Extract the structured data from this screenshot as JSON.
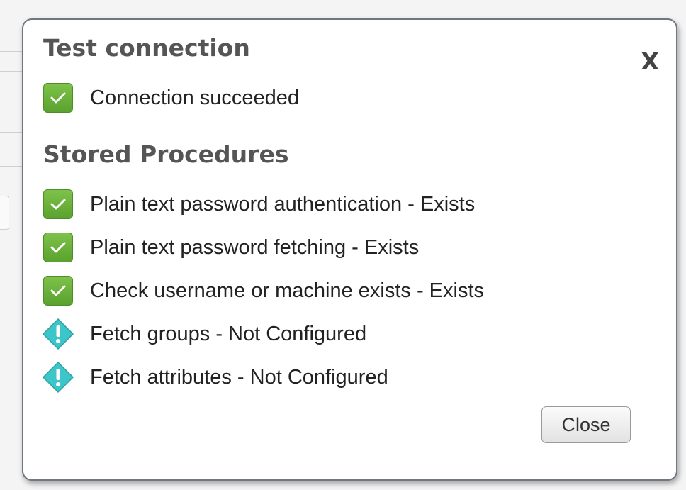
{
  "dialog": {
    "title": "Test connection",
    "close_x": "X",
    "connection_status": {
      "label": "Connection succeeded",
      "icon": "check-icon"
    },
    "section_title": "Stored Procedures",
    "procedures": [
      {
        "label": "Plain text password authentication - Exists",
        "icon": "check-icon"
      },
      {
        "label": "Plain text password fetching - Exists",
        "icon": "check-icon"
      },
      {
        "label": "Check username or machine exists - Exists",
        "icon": "check-icon"
      },
      {
        "label": "Fetch groups - Not Configured",
        "icon": "warning-icon"
      },
      {
        "label": "Fetch attributes - Not Configured",
        "icon": "warning-icon"
      }
    ],
    "close_button_label": "Close"
  },
  "colors": {
    "success_green": "#6db23c",
    "warning_teal": "#3cc6c9",
    "heading_gray": "#555555"
  }
}
